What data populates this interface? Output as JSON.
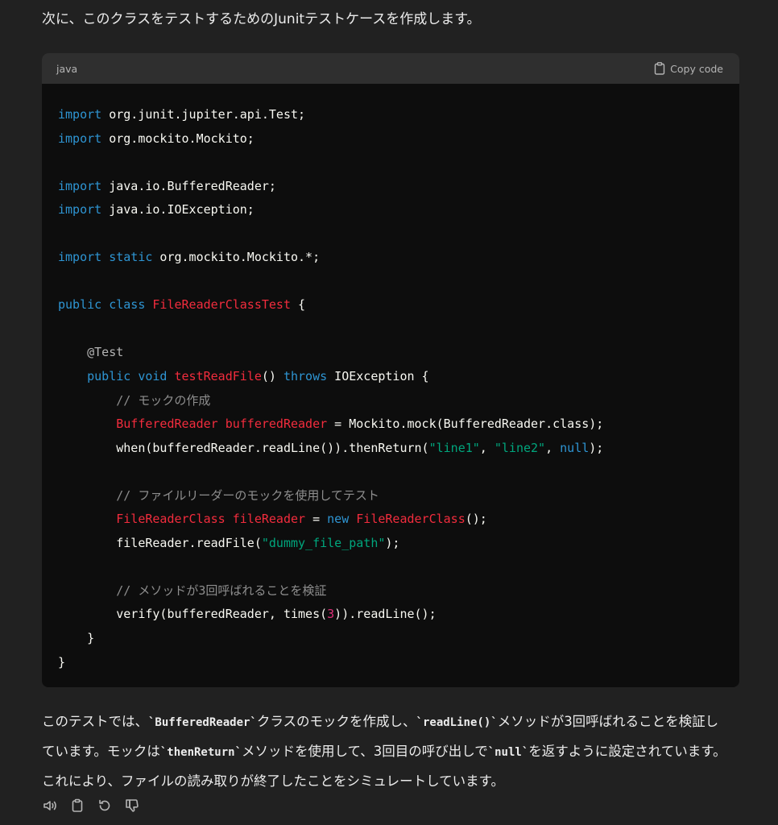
{
  "intro_text": "次に、このクラスをテストするためのJunitテストケースを作成します。",
  "code_block": {
    "language": "java",
    "copy_label": "Copy code",
    "lines": [
      [
        {
          "t": "import",
          "c": "kw"
        },
        {
          "t": " org.junit.jupiter.api.Test;"
        }
      ],
      [
        {
          "t": "import",
          "c": "kw"
        },
        {
          "t": " org.mockito.Mockito;"
        }
      ],
      [],
      [
        {
          "t": "import",
          "c": "kw"
        },
        {
          "t": " java.io.BufferedReader;"
        }
      ],
      [
        {
          "t": "import",
          "c": "kw"
        },
        {
          "t": " java.io.IOException;"
        }
      ],
      [],
      [
        {
          "t": "import",
          "c": "kw"
        },
        {
          "t": " "
        },
        {
          "t": "static",
          "c": "kw"
        },
        {
          "t": " org.mockito.Mockito.*;"
        }
      ],
      [],
      [
        {
          "t": "public",
          "c": "kw"
        },
        {
          "t": " "
        },
        {
          "t": "class",
          "c": "kw"
        },
        {
          "t": " "
        },
        {
          "t": "FileReaderClassTest",
          "c": "cls"
        },
        {
          "t": " {"
        }
      ],
      [],
      [
        {
          "t": "    "
        },
        {
          "t": "@Test",
          "c": "ann"
        }
      ],
      [
        {
          "t": "    "
        },
        {
          "t": "public",
          "c": "kw"
        },
        {
          "t": " "
        },
        {
          "t": "void",
          "c": "kw"
        },
        {
          "t": " "
        },
        {
          "t": "testReadFile",
          "c": "cls"
        },
        {
          "t": "() "
        },
        {
          "t": "throws",
          "c": "kw"
        },
        {
          "t": " IOException {"
        }
      ],
      [
        {
          "t": "        "
        },
        {
          "t": "// モックの作成",
          "c": "cm"
        }
      ],
      [
        {
          "t": "        "
        },
        {
          "t": "BufferedReader",
          "c": "cls"
        },
        {
          "t": " "
        },
        {
          "t": "bufferedReader",
          "c": "cls"
        },
        {
          "t": " = Mockito.mock(BufferedReader.class);"
        }
      ],
      [
        {
          "t": "        when(bufferedReader.readLine()).thenReturn("
        },
        {
          "t": "\"line1\"",
          "c": "str"
        },
        {
          "t": ", "
        },
        {
          "t": "\"line2\"",
          "c": "str"
        },
        {
          "t": ", "
        },
        {
          "t": "null",
          "c": "kw"
        },
        {
          "t": ");"
        }
      ],
      [],
      [
        {
          "t": "        "
        },
        {
          "t": "// ファイルリーダーのモックを使用してテスト",
          "c": "cm"
        }
      ],
      [
        {
          "t": "        "
        },
        {
          "t": "FileReaderClass",
          "c": "cls"
        },
        {
          "t": " "
        },
        {
          "t": "fileReader",
          "c": "cls"
        },
        {
          "t": " = "
        },
        {
          "t": "new",
          "c": "kw"
        },
        {
          "t": " "
        },
        {
          "t": "FileReaderClass",
          "c": "cls"
        },
        {
          "t": "();"
        }
      ],
      [
        {
          "t": "        fileReader.readFile("
        },
        {
          "t": "\"dummy_file_path\"",
          "c": "str"
        },
        {
          "t": ");"
        }
      ],
      [],
      [
        {
          "t": "        "
        },
        {
          "t": "// メソッドが3回呼ばれることを検証",
          "c": "cm"
        }
      ],
      [
        {
          "t": "        verify(bufferedReader, times("
        },
        {
          "t": "3",
          "c": "num"
        },
        {
          "t": ")).readLine();"
        }
      ],
      [
        {
          "t": "    }"
        }
      ],
      [
        {
          "t": "}"
        }
      ]
    ]
  },
  "outro": {
    "line1_a": "このテストでは、",
    "code1": "`BufferedReader`",
    "line1_b": "クラスのモックを作成し、",
    "code2": "`readLine()`",
    "line1_c": "メソッドが3回呼ばれることを検証し",
    "line2_a": "ています。モックは",
    "code3": "`thenReturn`",
    "line2_b": "メソッドを使用して、3回目の呼び出しで",
    "code4": "`null`",
    "line2_c": "を返すように設定されています。",
    "line3": "これにより、ファイルの読み取りが終了したことをシミュレートしています。"
  },
  "actions": {
    "icons": [
      "speaker-icon",
      "clipboard-icon",
      "regenerate-icon",
      "thumbs-down-icon"
    ]
  },
  "colors": {
    "background": "#212121",
    "code_bg": "#0d0d0d",
    "code_header_bg": "#2f2f2f",
    "keyword": "#2e95d3",
    "class_name": "#f22c3d",
    "string": "#00a67d",
    "number": "#df3079",
    "comment": "#8e8e8e"
  }
}
